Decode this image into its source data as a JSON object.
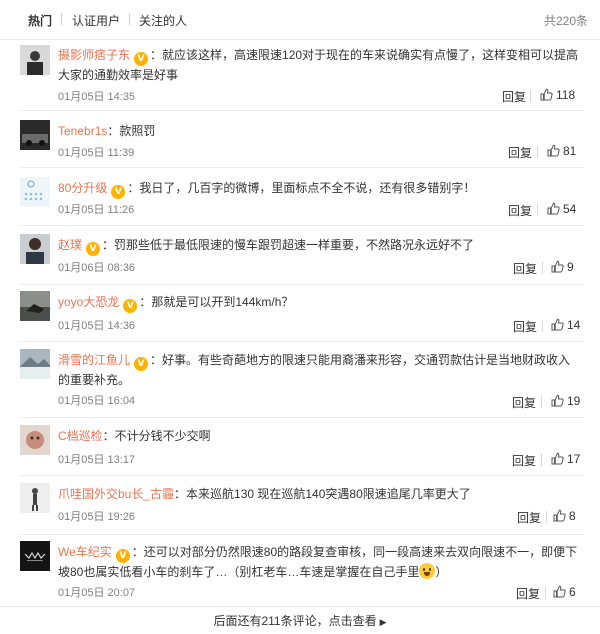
{
  "tabs": [
    {
      "label": "热门",
      "active": true
    },
    {
      "label": "认证用户",
      "active": false
    },
    {
      "label": "关注的人",
      "active": false
    }
  ],
  "total_label": "共220条",
  "reply_label": "回复",
  "comments": [
    {
      "username": "摄影师痞子东",
      "badge": "V",
      "text": "：就应该这样，高速限速120对于现在的车来说确实有点慢了，这样变相可以提高大家的通勤效率是好事",
      "time": "01月05日 14:35",
      "likes": "118"
    },
    {
      "username": "Tenebr1s",
      "badge": "",
      "text": "：款照罚",
      "time": "01月05日 11:39",
      "likes": "81"
    },
    {
      "username": "80分升级",
      "badge": "V",
      "text": "：我日了，几百字的微博，里面标点不全不说，还有很多错别字！",
      "time": "01月05日 11:26",
      "likes": "54"
    },
    {
      "username": "赵璞",
      "badge": "V",
      "text": "：罚那些低于最低限速的慢车跟罚超速一样重要，不然路况永远好不了",
      "time": "01月06日 08:36",
      "likes": "9"
    },
    {
      "username": "yoyo大恐龙",
      "badge": "V",
      "text": "：那就是可以开到144km/h？",
      "time": "01月05日 14:36",
      "likes": "14"
    },
    {
      "username": "滑雪的江鱼儿",
      "badge": "V",
      "text": "：好事。有些奇葩地方的限速只能用裔潘来形容，交通罚款估计是当地财政收入的重要补充。",
      "time": "01月05日 16:04",
      "likes": "19"
    },
    {
      "username": "C档巡检",
      "badge": "",
      "text": "：不计分钱不少交啊",
      "time": "01月05日 13:17",
      "likes": "17"
    },
    {
      "username": "爪哇国外交bu长_古霾",
      "badge": "",
      "text": "：本来巡航130 现在巡航140突遇80限速追尾几率更大了",
      "time": "01月05日 19:26",
      "likes": "8"
    },
    {
      "username": "We车纪实",
      "badge": "V",
      "text": "：还可以对部分仍然限速80的路段复查审核，同一段高速来去双向限速不一，即便下坡80也属实低看小车的刹车了…（别杠老车…车速是掌握在自己手里",
      "text_end": "）",
      "time": "01月05日 20:07",
      "likes": "6"
    }
  ],
  "footer": {
    "label": "后面还有211条评论，点击查看",
    "arrow": "▶"
  }
}
